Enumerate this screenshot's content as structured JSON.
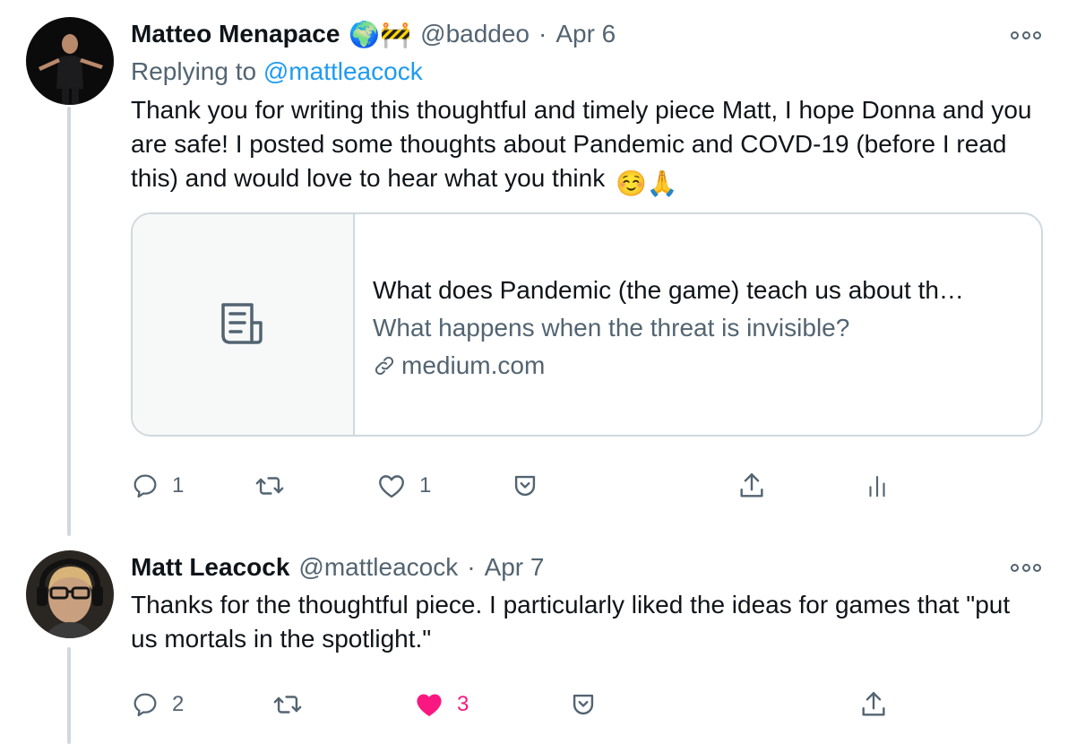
{
  "tweets": [
    {
      "author_name": "Matteo Menapace",
      "badges": "🌍🚧",
      "handle": "@baddeo",
      "date": "Apr 6",
      "replying_label": "Replying to",
      "replying_handle": "@mattleacock",
      "text": "Thank you for writing this thoughtful and timely piece Matt, I hope Donna and you are safe! I posted some thoughts about Pandemic and COVD-19 (before I read this) and would love to hear what you think",
      "text_emoji": "☺️🙏",
      "card": {
        "title": "What does Pandemic (the game) teach us about th…",
        "description": "What happens when the threat is invisible?",
        "domain": "medium.com"
      },
      "counts": {
        "replies": "1",
        "retweets": "",
        "likes": "1"
      }
    },
    {
      "author_name": "Matt Leacock",
      "handle": "@mattleacock",
      "date": "Apr 7",
      "text": "Thanks for the thoughtful piece. I particularly liked the ideas for games that \"put us mortals in the spotlight.\"",
      "counts": {
        "replies": "2",
        "retweets": "",
        "likes": "3"
      },
      "liked": true
    }
  ],
  "colors": {
    "secondary_text": "#536471",
    "link": "#1d9bf0",
    "like_active": "#f91880",
    "border": "#cfd9de"
  },
  "icons": [
    "more-icon",
    "reply-icon",
    "retweet-icon",
    "like-icon",
    "bookmark-icon",
    "share-icon",
    "analytics-icon",
    "article-icon",
    "link-icon"
  ]
}
